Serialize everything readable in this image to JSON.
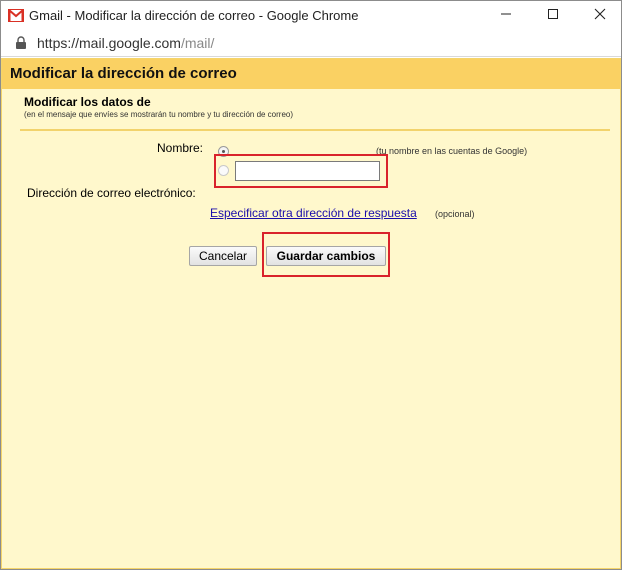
{
  "window": {
    "title": "Gmail - Modificar la dirección de correo - Google Chrome",
    "url_base": "https://mail.google.com",
    "url_rest": "/mail/"
  },
  "dialog": {
    "header": "Modificar la dirección de correo",
    "section_title": "Modificar los datos de",
    "section_subtitle": "(en el mensaje que envíes se mostrarán tu nombre y tu dirección de correo)",
    "name_label": "Nombre:",
    "name_hint": "(tu nombre en las cuentas de Google)",
    "name_input_value": "",
    "email_label": "Dirección de correo electrónico:",
    "reply_link": "Especificar otra dirección de respuesta",
    "reply_optional": "(opcional)",
    "cancel_label": "Cancelar",
    "save_label": "Guardar cambios"
  },
  "colors": {
    "header_bg": "#fad163",
    "panel_bg": "#fff8cc",
    "highlight": "#d9232b",
    "link": "#1a0dab"
  },
  "icons": {
    "app": "gmail-logo-icon",
    "minimize": "minimize-icon",
    "maximize": "maximize-icon",
    "close": "close-icon",
    "lock": "lock-icon"
  }
}
